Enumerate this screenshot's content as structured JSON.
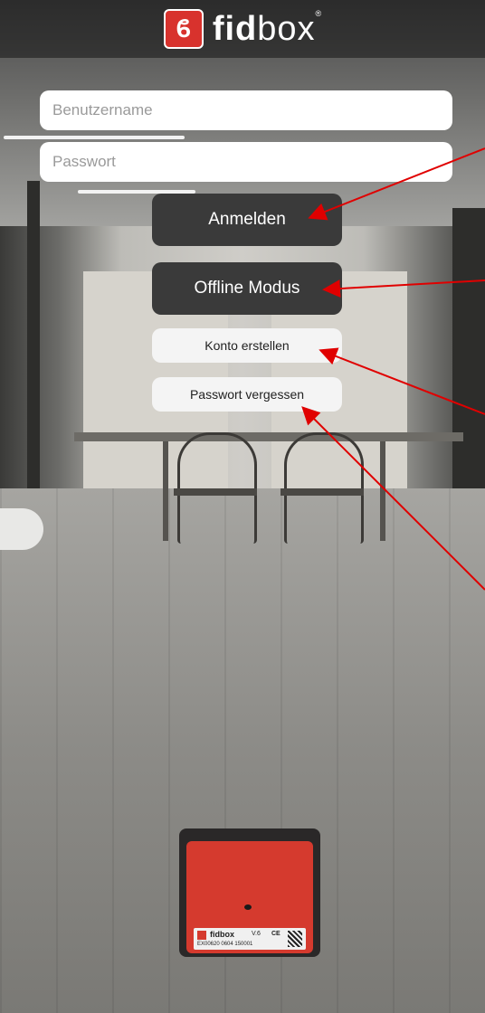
{
  "header": {
    "logo_mark": "ϐ",
    "brand_bold": "fid",
    "brand_light": "box",
    "reg_mark": "®"
  },
  "login": {
    "username_placeholder": "Benutzername",
    "password_placeholder": "Passwort",
    "login_button": "Anmelden",
    "offline_button": "Offline Modus",
    "create_account_button": "Konto erstellen",
    "forgot_password_button": "Passwort vergessen"
  },
  "device": {
    "label_name": "fidbox",
    "label_version": "V.6",
    "label_ce": "CE",
    "label_serial": "EX00620 0604 150001"
  },
  "colors": {
    "brand_red": "#d8322d",
    "dark_button": "#3a3a3a",
    "annotation_arrow": "#e00000"
  },
  "icons": [
    "fidbox-logo-icon",
    "qr-code-icon"
  ]
}
